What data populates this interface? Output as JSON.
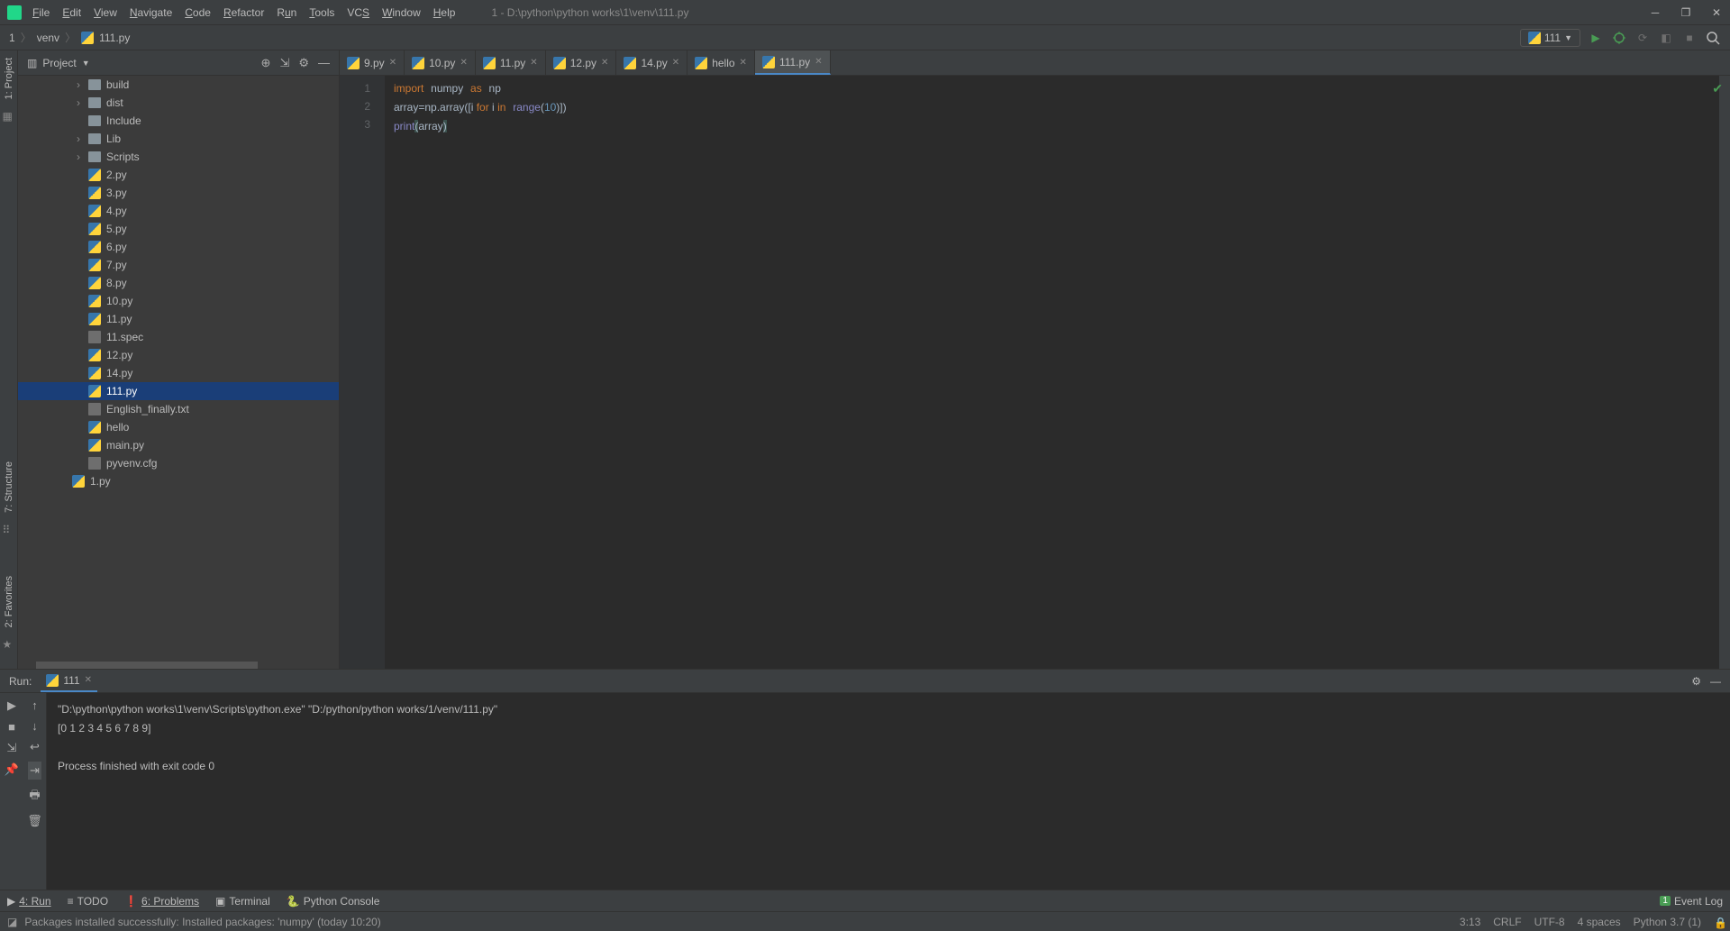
{
  "titlebar": {
    "path": "1 - D:\\python\\python works\\1\\venv\\111.py"
  },
  "menubar": [
    "File",
    "Edit",
    "View",
    "Navigate",
    "Code",
    "Refactor",
    "Run",
    "Tools",
    "VCS",
    "Window",
    "Help"
  ],
  "breadcrumb": {
    "root": "1",
    "folder": "venv",
    "file": "111.py"
  },
  "run_config": {
    "label": "111"
  },
  "project": {
    "title": "Project",
    "items": [
      {
        "type": "folder",
        "name": "build",
        "arrow": true,
        "depth": 1
      },
      {
        "type": "folder",
        "name": "dist",
        "arrow": true,
        "depth": 1
      },
      {
        "type": "folder",
        "name": "Include",
        "arrow": false,
        "depth": 1
      },
      {
        "type": "folder",
        "name": "Lib",
        "arrow": true,
        "depth": 1
      },
      {
        "type": "folder",
        "name": "Scripts",
        "arrow": true,
        "depth": 1
      },
      {
        "type": "py",
        "name": "2.py",
        "depth": 1
      },
      {
        "type": "py",
        "name": "3.py",
        "depth": 1
      },
      {
        "type": "py",
        "name": "4.py",
        "depth": 1
      },
      {
        "type": "py",
        "name": "5.py",
        "depth": 1
      },
      {
        "type": "py",
        "name": "6.py",
        "depth": 1
      },
      {
        "type": "py",
        "name": "7.py",
        "depth": 1
      },
      {
        "type": "py",
        "name": "8.py",
        "depth": 1
      },
      {
        "type": "py",
        "name": "10.py",
        "depth": 1
      },
      {
        "type": "py",
        "name": "11.py",
        "depth": 1
      },
      {
        "type": "txt",
        "name": "11.spec",
        "depth": 1
      },
      {
        "type": "py",
        "name": "12.py",
        "depth": 1
      },
      {
        "type": "py",
        "name": "14.py",
        "depth": 1
      },
      {
        "type": "py",
        "name": "111.py",
        "depth": 1,
        "selected": true
      },
      {
        "type": "txt",
        "name": "English_finally.txt",
        "depth": 1
      },
      {
        "type": "py",
        "name": "hello",
        "depth": 1
      },
      {
        "type": "py",
        "name": "main.py",
        "depth": 1
      },
      {
        "type": "txt",
        "name": "pyvenv.cfg",
        "depth": 1
      },
      {
        "type": "py",
        "name": "1.py",
        "depth": 0
      }
    ]
  },
  "tabs": [
    {
      "name": "9.py",
      "icon": "py"
    },
    {
      "name": "10.py",
      "icon": "py"
    },
    {
      "name": "11.py",
      "icon": "py"
    },
    {
      "name": "12.py",
      "icon": "py"
    },
    {
      "name": "14.py",
      "icon": "py"
    },
    {
      "name": "hello",
      "icon": "py"
    },
    {
      "name": "111.py",
      "icon": "py",
      "active": true
    }
  ],
  "editor": {
    "lines": [
      "1",
      "2",
      "3"
    ]
  },
  "code": {
    "l1": {
      "import": "import",
      "numpy": "numpy",
      "as": "as",
      "np": "np"
    },
    "l2": {
      "array": "array=np.array([i ",
      "for": "for",
      "i": " i ",
      "in": "in",
      "range": "range",
      "open": "(",
      "ten": "10",
      ")])": ")])"
    },
    "l3": {
      "print": "print",
      "open": "(",
      "arr": "array",
      "close": ")"
    }
  },
  "run": {
    "label": "Run:",
    "tab": "111",
    "output_line1": "\"D:\\python\\python works\\1\\venv\\Scripts\\python.exe\" \"D:/python/python works/1/venv/111.py\"",
    "output_line2": "[0 1 2 3 4 5 6 7 8 9]",
    "output_line3": "",
    "output_line4": "Process finished with exit code 0"
  },
  "left_gutter": {
    "project": "1: Project",
    "structure": "7: Structure",
    "favorites": "2: Favorites"
  },
  "bottom_tabs": {
    "run": "4: Run",
    "todo": "TODO",
    "problems": "6: Problems",
    "terminal": "Terminal",
    "python_console": "Python Console",
    "event_log": "Event Log",
    "badge": "1"
  },
  "statusbar": {
    "message": "Packages installed successfully: Installed packages: 'numpy' (today 10:20)",
    "cursor": "3:13",
    "eol": "CRLF",
    "encoding": "UTF-8",
    "indent": "4 spaces",
    "interpreter": "Python 3.7 (1)"
  }
}
